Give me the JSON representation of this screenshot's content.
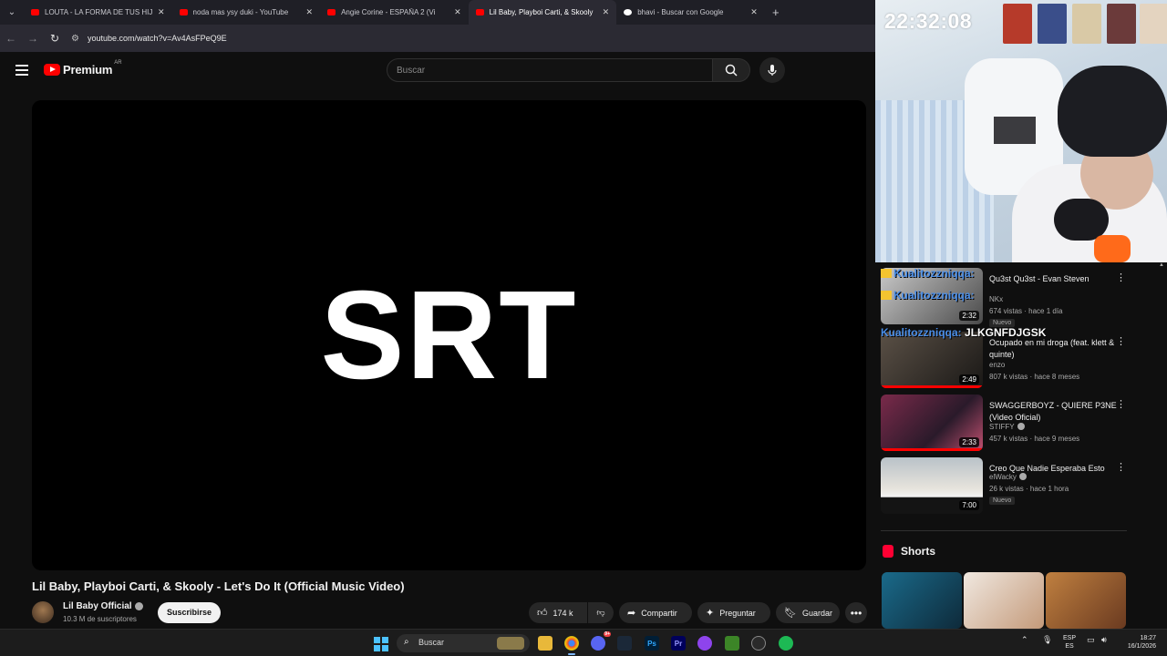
{
  "browser": {
    "tabs": [
      {
        "title": "LOUTA - LA FORMA DE TUS HIJOS",
        "icon": "youtube-icon",
        "active": false
      },
      {
        "title": "noda mas ysy duki - YouTube",
        "icon": "youtube-icon",
        "active": false
      },
      {
        "title": "Angie Corine - ESPAÑA 2 (Vi",
        "icon": "youtube-icon",
        "active": false
      },
      {
        "title": "Lil Baby, Playboi Carti, & Skooly",
        "icon": "youtube-icon",
        "active": true
      },
      {
        "title": "bhavi - Buscar con Google",
        "icon": "google-icon",
        "active": false
      }
    ],
    "url": "youtube.com/watch?v=Av4AsFPeQ9E"
  },
  "youtube": {
    "logo_text": "Premium",
    "country": "AR",
    "search_placeholder": "Buscar"
  },
  "player": {
    "overlay_text": "SRT"
  },
  "video": {
    "title": "Lil Baby, Playboi Carti, & Skooly - Let's Do It (Official Music Video)",
    "channel": "Lil Baby Official",
    "subscribers": "10.3 M de suscriptores",
    "subscribe_label": "Suscribirse",
    "likes": "174 k",
    "share_label": "Compartir",
    "ask_label": "Preguntar",
    "save_label": "Guardar"
  },
  "stream": {
    "clock": "22:32:08",
    "chat": [
      {
        "user": "Kualitozzniqqa:",
        "message": ""
      },
      {
        "user": "Kualitozzniqqa:",
        "message": ""
      },
      {
        "user": "Kualitozzniqqa:",
        "message": "JLKGNFDJGSK"
      }
    ]
  },
  "sidebar": {
    "items": [
      {
        "title": "Qu3st Qu3st - Evan Steven",
        "channel": "NKx",
        "meta": "674 vistas · hace 1 día",
        "badge": "Nuevo",
        "duration": "2:32",
        "verified": false
      },
      {
        "title": "Ocupado en mi droga (feat. klett & quinte)",
        "channel": "enzo",
        "meta": "807 k vistas · hace 8 meses",
        "badge": "",
        "duration": "2:49",
        "verified": false
      },
      {
        "title": "SWAGGERBOYZ - QUIERE P3NE (Video Oficial)",
        "channel": "STIFFY",
        "meta": "457 k vistas · hace 9 meses",
        "badge": "",
        "duration": "2:33",
        "verified": true
      },
      {
        "title": "Creo Que Nadie Esperaba Esto",
        "channel": "elWacky",
        "meta": "26 k vistas · hace 1 hora",
        "badge": "Nuevo",
        "duration": "7:00",
        "verified": true
      }
    ],
    "shorts_label": "Shorts"
  },
  "taskbar": {
    "search_label": "Buscar",
    "discord_badge": "9+",
    "lang_top": "ESP",
    "lang_bottom": "ES",
    "time": "18:27",
    "date": "16/1/2026"
  },
  "colors": {
    "youtube_red": "#ff0000",
    "chat_user": "#4a8ee8",
    "windows_blue": "#4cc2ff"
  }
}
